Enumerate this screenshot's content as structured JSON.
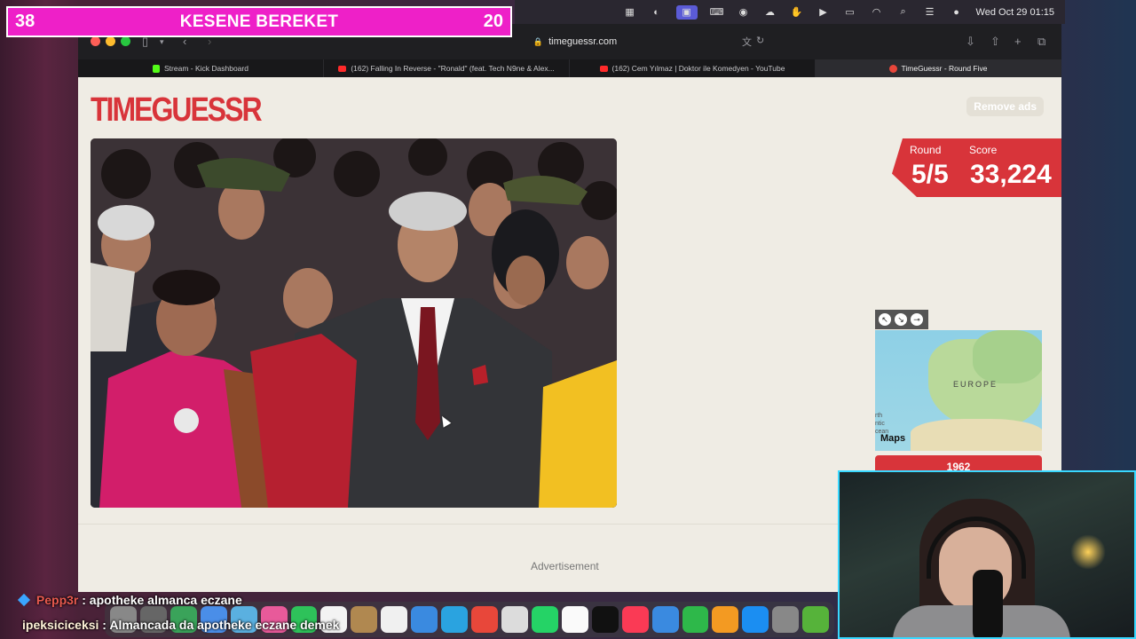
{
  "menubar": {
    "datetime": "Wed Oct 29  01:15"
  },
  "overlay": {
    "left_number": "38",
    "title": "KESENE BEREKET",
    "right_number": "20"
  },
  "browser": {
    "url": "timeguessr.com",
    "tabs": [
      {
        "label": "Stream - Kick Dashboard",
        "favicon": "kick-icon"
      },
      {
        "label": "(162) Falling In Reverse - \"Ronald\" (feat. Tech N9ne & Alex...",
        "favicon": "youtube-icon"
      },
      {
        "label": "(162) Cem Yılmaz | Doktor ile Komedyen - YouTube",
        "favicon": "youtube-icon"
      },
      {
        "label": "TimeGuessr - Round Five",
        "favicon": "timeguessr-icon"
      }
    ]
  },
  "page": {
    "logo": "TIMEGUESSR",
    "remove_ads": "Remove ads",
    "round_label": "Round",
    "round_value": "5/5",
    "score_label": "Score",
    "score_value": "33,224",
    "map_region_label": "EUROPE",
    "map_ocean_label": "rth\nntic\ncean",
    "map_brand": "Maps",
    "guess_button": "1962",
    "advertisement": "Advertisement",
    "accent_color": "#d8343a"
  },
  "chat": [
    {
      "user": "Pepp3r",
      "message": ": apotheke almanca eczane"
    },
    {
      "user": "ipeksiciceksi",
      "message": ": Almancada da apotheke eczane demek"
    }
  ]
}
